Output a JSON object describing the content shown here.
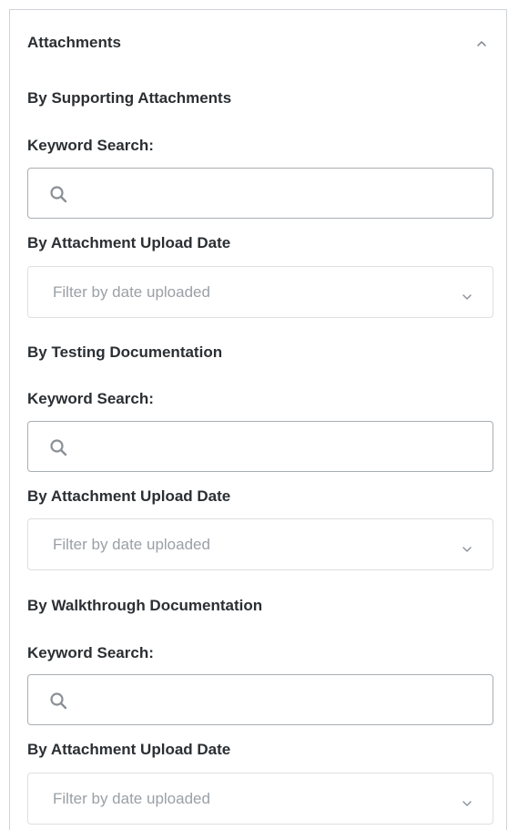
{
  "panel": {
    "title": "Attachments",
    "collapse_icon": "chevron-up-icon"
  },
  "sections": [
    {
      "title": "By Supporting Attachments",
      "keyword_label": "Keyword Search:",
      "search_value": "",
      "search_icon": "search-icon",
      "date_label": "By Attachment Upload Date",
      "date_placeholder": "Filter by date uploaded",
      "date_icon": "chevron-down-icon"
    },
    {
      "title": "By Testing Documentation",
      "keyword_label": "Keyword Search:",
      "search_value": "",
      "search_icon": "search-icon",
      "date_label": "By Attachment Upload Date",
      "date_placeholder": "Filter by date uploaded",
      "date_icon": "chevron-down-icon"
    },
    {
      "title": "By Walkthrough Documentation",
      "keyword_label": "Keyword Search:",
      "search_value": "",
      "search_icon": "search-icon",
      "date_label": "By Attachment Upload Date",
      "date_placeholder": "Filter by date uploaded",
      "date_icon": "chevron-down-icon"
    }
  ],
  "colors": {
    "text": "#2b2f33",
    "placeholder": "#9aa0a6",
    "border": "#a9aeb3",
    "border_light": "#dcdfe2",
    "icon": "#8a9096"
  }
}
